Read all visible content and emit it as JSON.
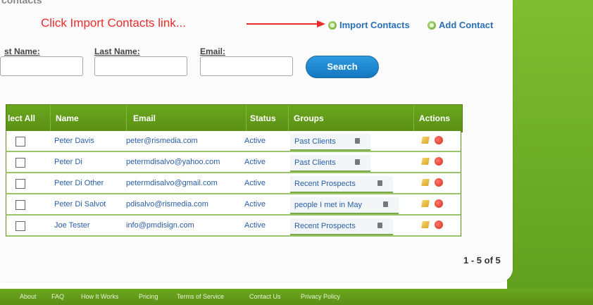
{
  "page": {
    "cutoff_title": "contacts",
    "callout": "Click Import Contacts link...",
    "import_contacts": "Import Contacts",
    "add_contact": "Add Contact"
  },
  "filters": {
    "first_name_label": "st Name:",
    "last_name_label": "Last Name:",
    "email_label": "Email:",
    "search_button": "Search"
  },
  "table": {
    "headers": [
      "lect All",
      "Name",
      "Email",
      "Status",
      "Groups",
      "Actions"
    ],
    "rows": [
      {
        "name": "Peter Davis",
        "email": "peter@rismedia.com",
        "status": "Active",
        "group": "Past Clients"
      },
      {
        "name": "Peter Di",
        "email": "petermdisalvo@yahoo.com",
        "status": "Active",
        "group": "Past Clients"
      },
      {
        "name": "Peter Di Other",
        "email": "petermdisalvo@gmail.com",
        "status": "Active",
        "group": "Recent Prospects"
      },
      {
        "name": "Peter Di Salvot",
        "email": "pdisalvo@rismedia.com",
        "status": "Active",
        "group": "people I met in May"
      },
      {
        "name": "Joe Tester",
        "email": "info@pmdisign.com",
        "status": "Active",
        "group": "Recent Prospects"
      }
    ],
    "pagination": "1 - 5 of 5"
  },
  "footer": {
    "links": [
      "About",
      "FAQ",
      "How It Works",
      "Pricing",
      "Terms of Service",
      "Contact Us",
      "Privacy Policy"
    ]
  },
  "colors": {
    "brand_green": "#5b8f15",
    "callout_red": "#ee2a2a",
    "link_blue": "#2a6fb5",
    "search_blue": "#1577bf"
  },
  "icons": {
    "import": "plus-icon",
    "add": "plus-icon",
    "group_remove": "trash-icon",
    "edit": "edit-icon",
    "delete": "delete-icon"
  }
}
